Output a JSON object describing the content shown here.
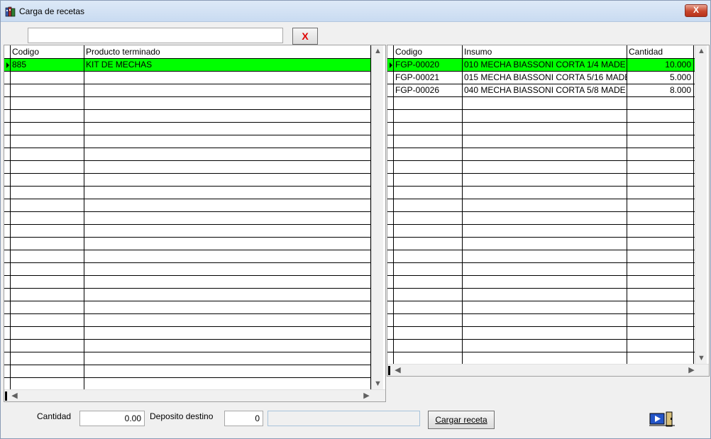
{
  "window": {
    "title": "Carga de recetas",
    "close_label": "X"
  },
  "search": {
    "value": "",
    "clear_label": "X"
  },
  "left_grid": {
    "columns": [
      "Codigo",
      "Producto terminado"
    ],
    "rows": [
      {
        "codigo": "885",
        "producto": "KIT DE MECHAS",
        "selected": true
      }
    ]
  },
  "right_grid": {
    "columns": [
      "Codigo",
      "Insumo",
      "Cantidad"
    ],
    "rows": [
      {
        "codigo": "FGP-00020",
        "insumo": "010 MECHA BIASSONI CORTA  1/4  MADE",
        "cantidad": "10.000",
        "selected": true
      },
      {
        "codigo": "FGP-00021",
        "insumo": "015 MECHA BIASSONI CORTA  5/16 MADE",
        "cantidad": "5.000",
        "selected": false
      },
      {
        "codigo": "FGP-00026",
        "insumo": "040 MECHA BIASSONI CORTA  5/8 MADE",
        "cantidad": "8.000",
        "selected": false
      }
    ]
  },
  "footer": {
    "cantidad_label": "Cantidad",
    "cantidad_value": "0.00",
    "deposito_label": "Deposito destino",
    "deposito_value": "0",
    "cargar_label": "Cargar receta"
  },
  "icons": {
    "app": "books-icon",
    "exit": "exit-door-icon",
    "scroll_up": "▲",
    "scroll_down": "▼",
    "scroll_left": "◀",
    "scroll_right": "▶"
  },
  "colors": {
    "selected_row": "#00ff00",
    "clear_x": "#e00000"
  }
}
